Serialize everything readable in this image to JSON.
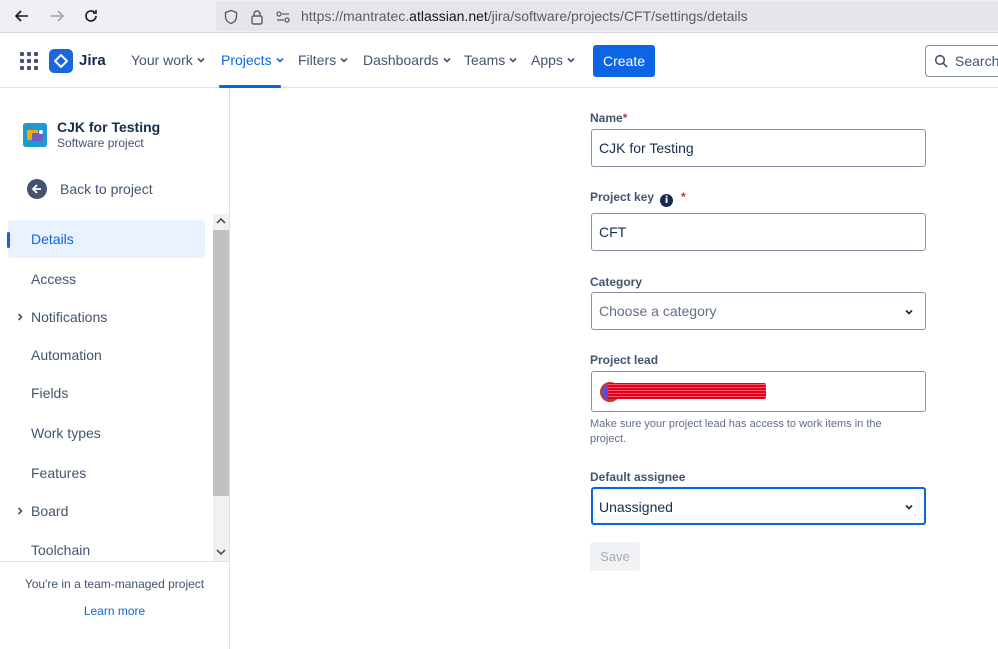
{
  "browser": {
    "url_prefix": "https://mantratec.",
    "url_domain": "atlassian.net",
    "url_path": "/jira/software/projects/CFT/settings/details"
  },
  "topnav": {
    "product": "Jira",
    "items": [
      {
        "label": "Your work"
      },
      {
        "label": "Projects"
      },
      {
        "label": "Filters"
      },
      {
        "label": "Dashboards"
      },
      {
        "label": "Teams"
      },
      {
        "label": "Apps"
      }
    ],
    "create_label": "Create",
    "search_placeholder": "Search"
  },
  "sidebar": {
    "project_name": "CJK for Testing",
    "project_type": "Software project",
    "back_label": "Back to project",
    "items": [
      {
        "label": "Details"
      },
      {
        "label": "Access"
      },
      {
        "label": "Notifications"
      },
      {
        "label": "Automation"
      },
      {
        "label": "Fields"
      },
      {
        "label": "Work types"
      },
      {
        "label": "Features"
      },
      {
        "label": "Board"
      },
      {
        "label": "Toolchain"
      }
    ],
    "footer_text": "You're in a team-managed project",
    "learn_more": "Learn more"
  },
  "form": {
    "name_label": "Name",
    "name_value": "CJK for Testing",
    "key_label": "Project key",
    "key_value": "CFT",
    "category_label": "Category",
    "category_placeholder": "Choose a category",
    "lead_label": "Project lead",
    "lead_helper": "Make sure your project lead has access to work items in the project.",
    "assignee_label": "Default assignee",
    "assignee_value": "Unassigned",
    "save_label": "Save",
    "required_mark": "*",
    "info_glyph": "i"
  },
  "colors": {
    "brand": "#0c66e4",
    "required": "#c9372c"
  }
}
